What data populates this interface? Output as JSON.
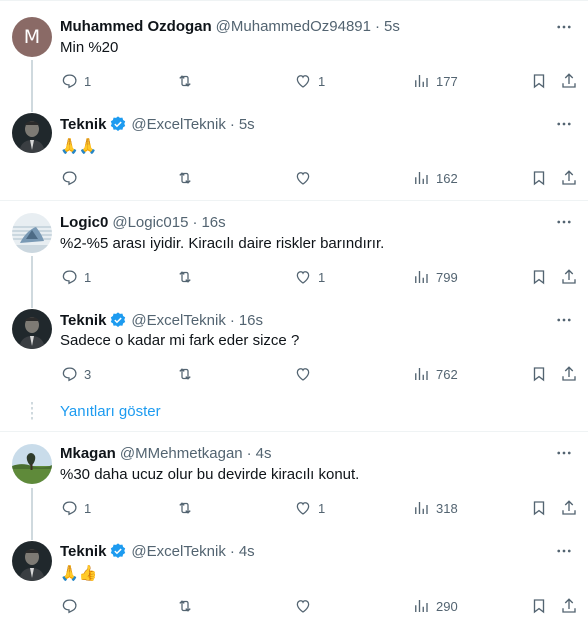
{
  "tweets": [
    {
      "avatar_letter": "M",
      "name": "Muhammed Ozdogan",
      "handle": "@MuhammedOz94891",
      "time": "5s",
      "text": "Min %20",
      "replies": "1",
      "retweets": "",
      "likes": "1",
      "views": "177"
    },
    {
      "name": "Teknik",
      "handle": "@ExcelTeknik",
      "time": "5s",
      "text": "🙏🙏",
      "replies": "",
      "retweets": "",
      "likes": "",
      "views": "162"
    },
    {
      "name": "Logic0",
      "handle": "@Logic015",
      "time": "16s",
      "text": "%2-%5 arası iyidir. Kiracılı daire riskler barındırır.",
      "replies": "1",
      "retweets": "",
      "likes": "1",
      "views": "799"
    },
    {
      "name": "Teknik",
      "handle": "@ExcelTeknik",
      "time": "16s",
      "text": "Sadece o kadar mi fark eder sizce ?",
      "replies": "3",
      "retweets": "",
      "likes": "",
      "views": "762"
    },
    {
      "name": "Mkagan",
      "handle": "@MMehmetkagan",
      "time": "4s",
      "text": "%30 daha ucuz olur bu devirde kiracılı konut.",
      "replies": "1",
      "retweets": "",
      "likes": "1",
      "views": "318"
    },
    {
      "name": "Teknik",
      "handle": "@ExcelTeknik",
      "time": "4s",
      "text": "🙏👍",
      "replies": "",
      "retweets": "",
      "likes": "",
      "views": "290"
    }
  ],
  "show_replies": "Yanıtları göster",
  "dot": "·",
  "colors": {
    "accent": "#1d9bf0",
    "muted": "#536471",
    "verified": "#1d9bf0"
  },
  "icons": [
    "reply-icon",
    "retweet-icon",
    "like-icon",
    "views-icon",
    "bookmark-icon",
    "share-icon",
    "more-icon",
    "verified-badge-icon"
  ]
}
